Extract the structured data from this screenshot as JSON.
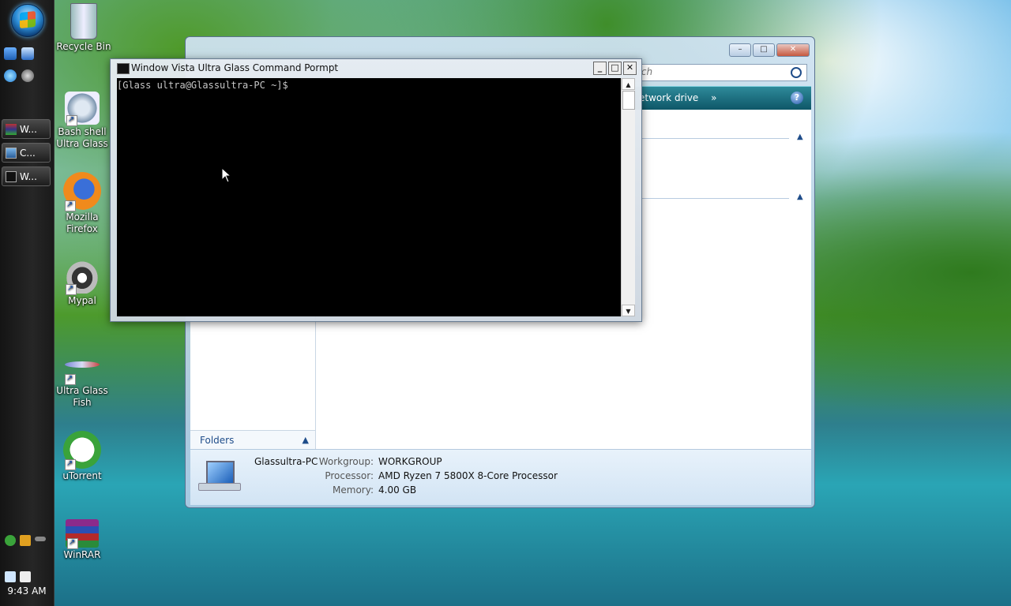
{
  "taskbar": {
    "buttons": [
      {
        "label": "W...",
        "icon": "winrar-icon"
      },
      {
        "label": "C...",
        "icon": "computer-icon"
      },
      {
        "label": "W...",
        "icon": "terminal-icon"
      }
    ],
    "clock": "9:43 AM"
  },
  "desktop_icons": [
    {
      "label": "Recycle Bin",
      "icon": "recycle-bin-icon"
    },
    {
      "label": "Bash shell\nUltra Glass",
      "icon": "gear-icon"
    },
    {
      "label": "Mozilla\nFirefox",
      "icon": "firefox-icon"
    },
    {
      "label": "Mypal",
      "icon": "raccoon-icon"
    },
    {
      "label": "Ultra Glass\nFish",
      "icon": "fish-icon"
    },
    {
      "label": "uTorrent",
      "icon": "utorrent-icon"
    },
    {
      "label": "WinRAR",
      "icon": "winrar-icon"
    }
  ],
  "explorer": {
    "search_placeholder": "rch",
    "toolbar_network_drive": "etwork drive",
    "toolbar_more": "»",
    "help": "?",
    "folders_label": "Folders",
    "details": {
      "pc_name": "Glassultra-PC",
      "workgroup_label": "Workgroup:",
      "workgroup_value": "WORKGROUP",
      "processor_label": "Processor:",
      "processor_value": "AMD Ryzen 7 5800X 8-Core Processor",
      "memory_label": "Memory:",
      "memory_value": "4.00 GB"
    }
  },
  "cmd": {
    "title": "Window Vista Ultra Glass Command Pormpt",
    "prompt": "[Glass ultra@Glassultra-PC ~]$",
    "minimize": "_",
    "maximize": "□",
    "close": "✕"
  }
}
